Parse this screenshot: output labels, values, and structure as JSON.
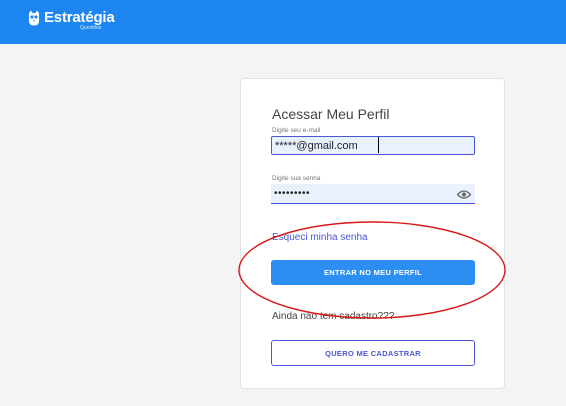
{
  "header": {
    "brand_name": "Estratégia",
    "brand_sub": "Questões",
    "background_color": "#1e86f0",
    "logo_icon": "owl-icon"
  },
  "login": {
    "title": "Acessar Meu Perfil",
    "email_label": "Digite seu e-mail",
    "email_value": "*****@gmail.com",
    "password_label": "Digite sua senha",
    "password_value": "•••••••••",
    "password_toggle_icon": "eye-icon",
    "forgot_link": "Esqueci minha senha",
    "submit_label": "ENTRAR NO MEU PERFIL",
    "no_account_text": "Ainda não tem cadastro???",
    "register_label": "QUERO ME CADASTRAR"
  },
  "colors": {
    "primary_button": "#2b8ef0",
    "accent": "#4a57d6",
    "annotation": "#d81818"
  }
}
